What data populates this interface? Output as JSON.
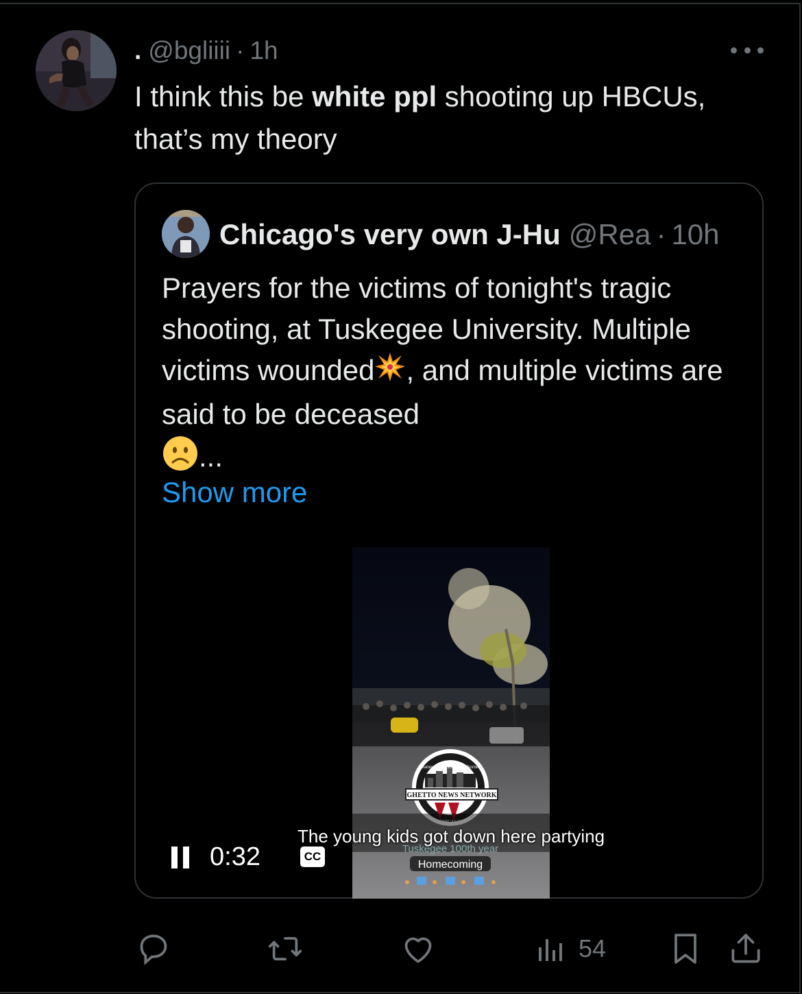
{
  "tweet": {
    "display_name": ".",
    "handle": "@bgliiii",
    "time": "1h",
    "text_before": "I think this be ",
    "text_bold": "white ppl",
    "text_after": " shooting up HBCUs, that’s my theory"
  },
  "quote": {
    "display_name": "Chicago's very own J-Hu",
    "handle": "@Rea",
    "time": "10h",
    "text_line1": "Prayers for the victims of tonight's tragic shooting, at Tuskegee University. Multiple victims wounded",
    "text_line2": ", and multiple victims are said to be deceased",
    "ellipsis": "...",
    "show_more": "Show more",
    "video": {
      "timecode": "0:32",
      "cc_label": "CC",
      "caption": "The young kids got down here partying",
      "overlay_title": "GHETTO NEWS NETWORK",
      "overlay_ring": "James J. \"Hustle\" Hawthorne",
      "overlay_city": "CHICAGO",
      "overlay_line1": "Tuskegee 100th year",
      "overlay_line2": "Homecoming"
    }
  },
  "actions": {
    "views": "54"
  },
  "icons": [
    "more-icon",
    "reply-icon",
    "retweet-icon",
    "like-icon",
    "views-icon",
    "bookmark-icon",
    "share-icon",
    "pause-icon",
    "cc-icon",
    "collision-emoji",
    "frown-emoji"
  ],
  "colors": {
    "background": "#000000",
    "text": "#e7e9ea",
    "muted": "#71767b",
    "link": "#1d9bf0",
    "border": "#2f3336"
  }
}
